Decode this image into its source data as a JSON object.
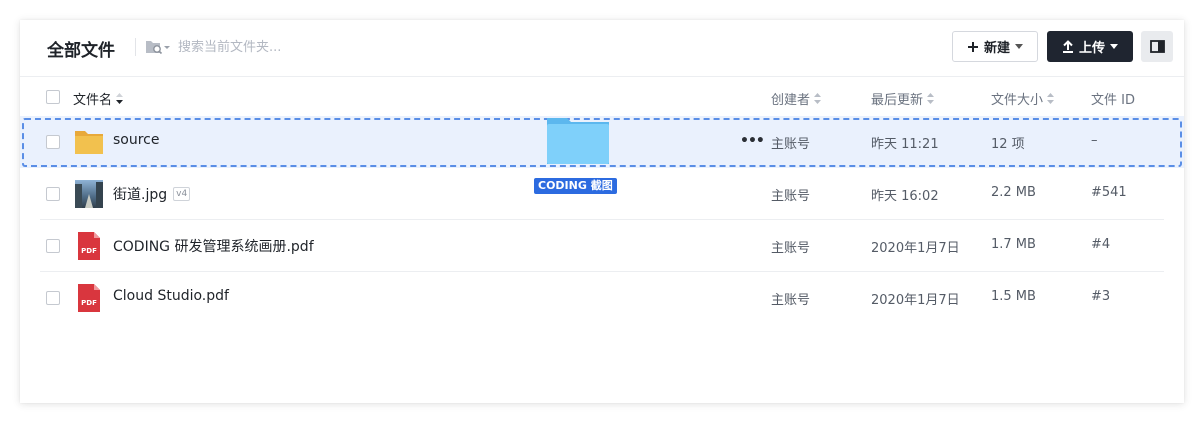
{
  "header": {
    "title": "全部文件",
    "search_placeholder": "搜索当前文件夹...",
    "new_button": "新建",
    "upload_button": "上传"
  },
  "columns": {
    "name": "文件名",
    "creator": "创建者",
    "updated": "最后更新",
    "size": "文件大小",
    "id": "文件 ID"
  },
  "rows": [
    {
      "name": "source",
      "type": "folder",
      "creator": "主账号",
      "updated": "昨天 11:21",
      "size": "12 项",
      "id": "–"
    },
    {
      "name": "街道.jpg",
      "type": "image",
      "version": "v4",
      "creator": "主账号",
      "updated": "昨天 16:02",
      "size": "2.2 MB",
      "id": "#541"
    },
    {
      "name": "CODING 研发管理系统画册.pdf",
      "type": "pdf",
      "creator": "主账号",
      "updated": "2020年1月7日",
      "size": "1.7 MB",
      "id": "#4"
    },
    {
      "name": "Cloud Studio.pdf",
      "type": "pdf",
      "creator": "主账号",
      "updated": "2020年1月7日",
      "size": "1.5 MB",
      "id": "#3"
    }
  ],
  "pdf_icon_text": "PDF",
  "drag": {
    "label": "CODING 截图"
  },
  "colors": {
    "accent": "#2c6be0",
    "upload_bg": "#1f2530",
    "pdf_red": "#d9363e",
    "folder_yellow": "#f2c14e",
    "highlight_bg": "#eaf1fd"
  }
}
